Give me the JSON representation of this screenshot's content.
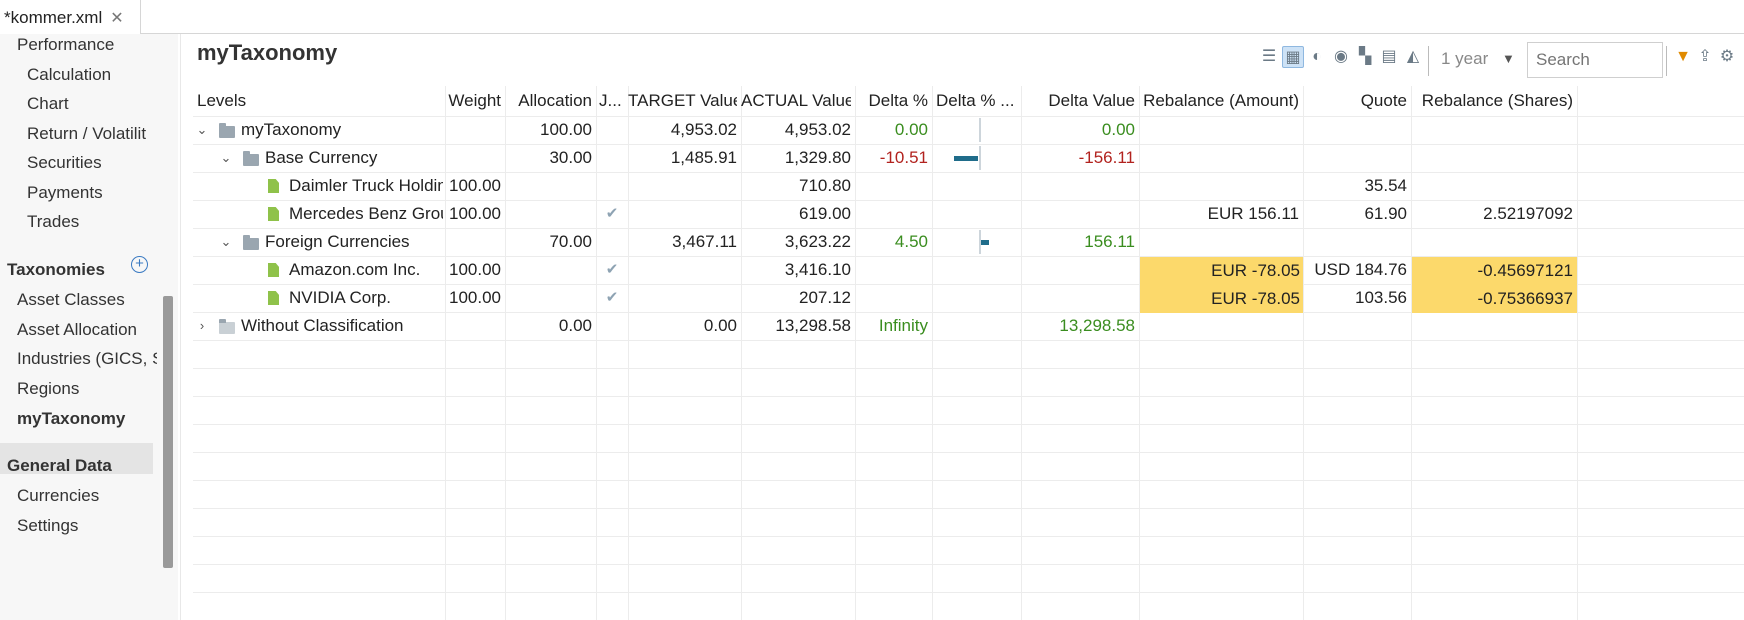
{
  "tab": {
    "title": "*kommer.xml",
    "close": "✕"
  },
  "sidebar": {
    "items_top": [
      "Performance",
      "Calculation",
      "Chart",
      "Return / Volatilit",
      "Securities",
      "Payments",
      "Trades"
    ],
    "taxonomies_title": "Taxonomies",
    "taxonomies": [
      "Asset Classes",
      "Asset Allocation",
      "Industries (GICS, S",
      "Regions",
      "myTaxonomy"
    ],
    "general_title": "General Data",
    "general": [
      "Currencies",
      "Settings"
    ]
  },
  "main": {
    "title": "myTaxonomy",
    "period": "1 year",
    "search_placeholder": "Search"
  },
  "table": {
    "headers": [
      "Levels",
      "Weight",
      "Allocation",
      "J...",
      "TARGET Value",
      "ACTUAL Value",
      "Delta %",
      "Delta % ...",
      "Delta Value",
      "Rebalance (Amount)",
      "Quote",
      "Rebalance (Shares)"
    ],
    "rows": [
      {
        "name": "myTaxonomy",
        "weight": "",
        "allocation": "100.00",
        "check": "",
        "target": "4,953.02",
        "actual": "4,953.02",
        "delta_pct": "0.00",
        "delta_value": "0.00",
        "rebal_amount": "",
        "quote": "",
        "rebal_shares": ""
      },
      {
        "name": "Base Currency",
        "weight": "",
        "allocation": "30.00",
        "check": "",
        "target": "1,485.91",
        "actual": "1,329.80",
        "delta_pct": "-10.51",
        "delta_value": "-156.11",
        "rebal_amount": "",
        "quote": "",
        "rebal_shares": ""
      },
      {
        "name": "Daimler Truck Holding AG",
        "weight": "100.00",
        "allocation": "",
        "check": "",
        "target": "",
        "actual": "710.80",
        "delta_pct": "",
        "delta_value": "",
        "rebal_amount": "",
        "quote": "35.54",
        "rebal_shares": ""
      },
      {
        "name": "Mercedes Benz Group AG",
        "weight": "100.00",
        "allocation": "",
        "check": "✔",
        "target": "",
        "actual": "619.00",
        "delta_pct": "",
        "delta_value": "",
        "rebal_amount": "EUR 156.11",
        "quote": "61.90",
        "rebal_shares": "2.52197092"
      },
      {
        "name": "Foreign Currencies",
        "weight": "",
        "allocation": "70.00",
        "check": "",
        "target": "3,467.11",
        "actual": "3,623.22",
        "delta_pct": "4.50",
        "delta_value": "156.11",
        "rebal_amount": "",
        "quote": "",
        "rebal_shares": ""
      },
      {
        "name": "Amazon.com Inc.",
        "weight": "100.00",
        "allocation": "",
        "check": "✔",
        "target": "",
        "actual": "3,416.10",
        "delta_pct": "",
        "delta_value": "",
        "rebal_amount": "EUR -78.05",
        "quote": "USD 184.76",
        "rebal_shares": "-0.45697121"
      },
      {
        "name": "NVIDIA Corp.",
        "weight": "100.00",
        "allocation": "",
        "check": "✔",
        "target": "",
        "actual": "207.12",
        "delta_pct": "",
        "delta_value": "",
        "rebal_amount": "EUR -78.05",
        "quote": "103.56",
        "rebal_shares": "-0.75366937"
      },
      {
        "name": "Without Classification",
        "weight": "",
        "allocation": "0.00",
        "check": "",
        "target": "0.00",
        "actual": "13,298.58",
        "delta_pct": "Infinity",
        "delta_value": "13,298.58",
        "rebal_amount": "",
        "quote": "",
        "rebal_shares": ""
      }
    ]
  },
  "colors": {
    "positive": "#3a8d1f",
    "negative": "#b2221e",
    "highlight": "#fcd96b",
    "bar": "#1f6c8a",
    "accent": "#3a7ac2"
  }
}
